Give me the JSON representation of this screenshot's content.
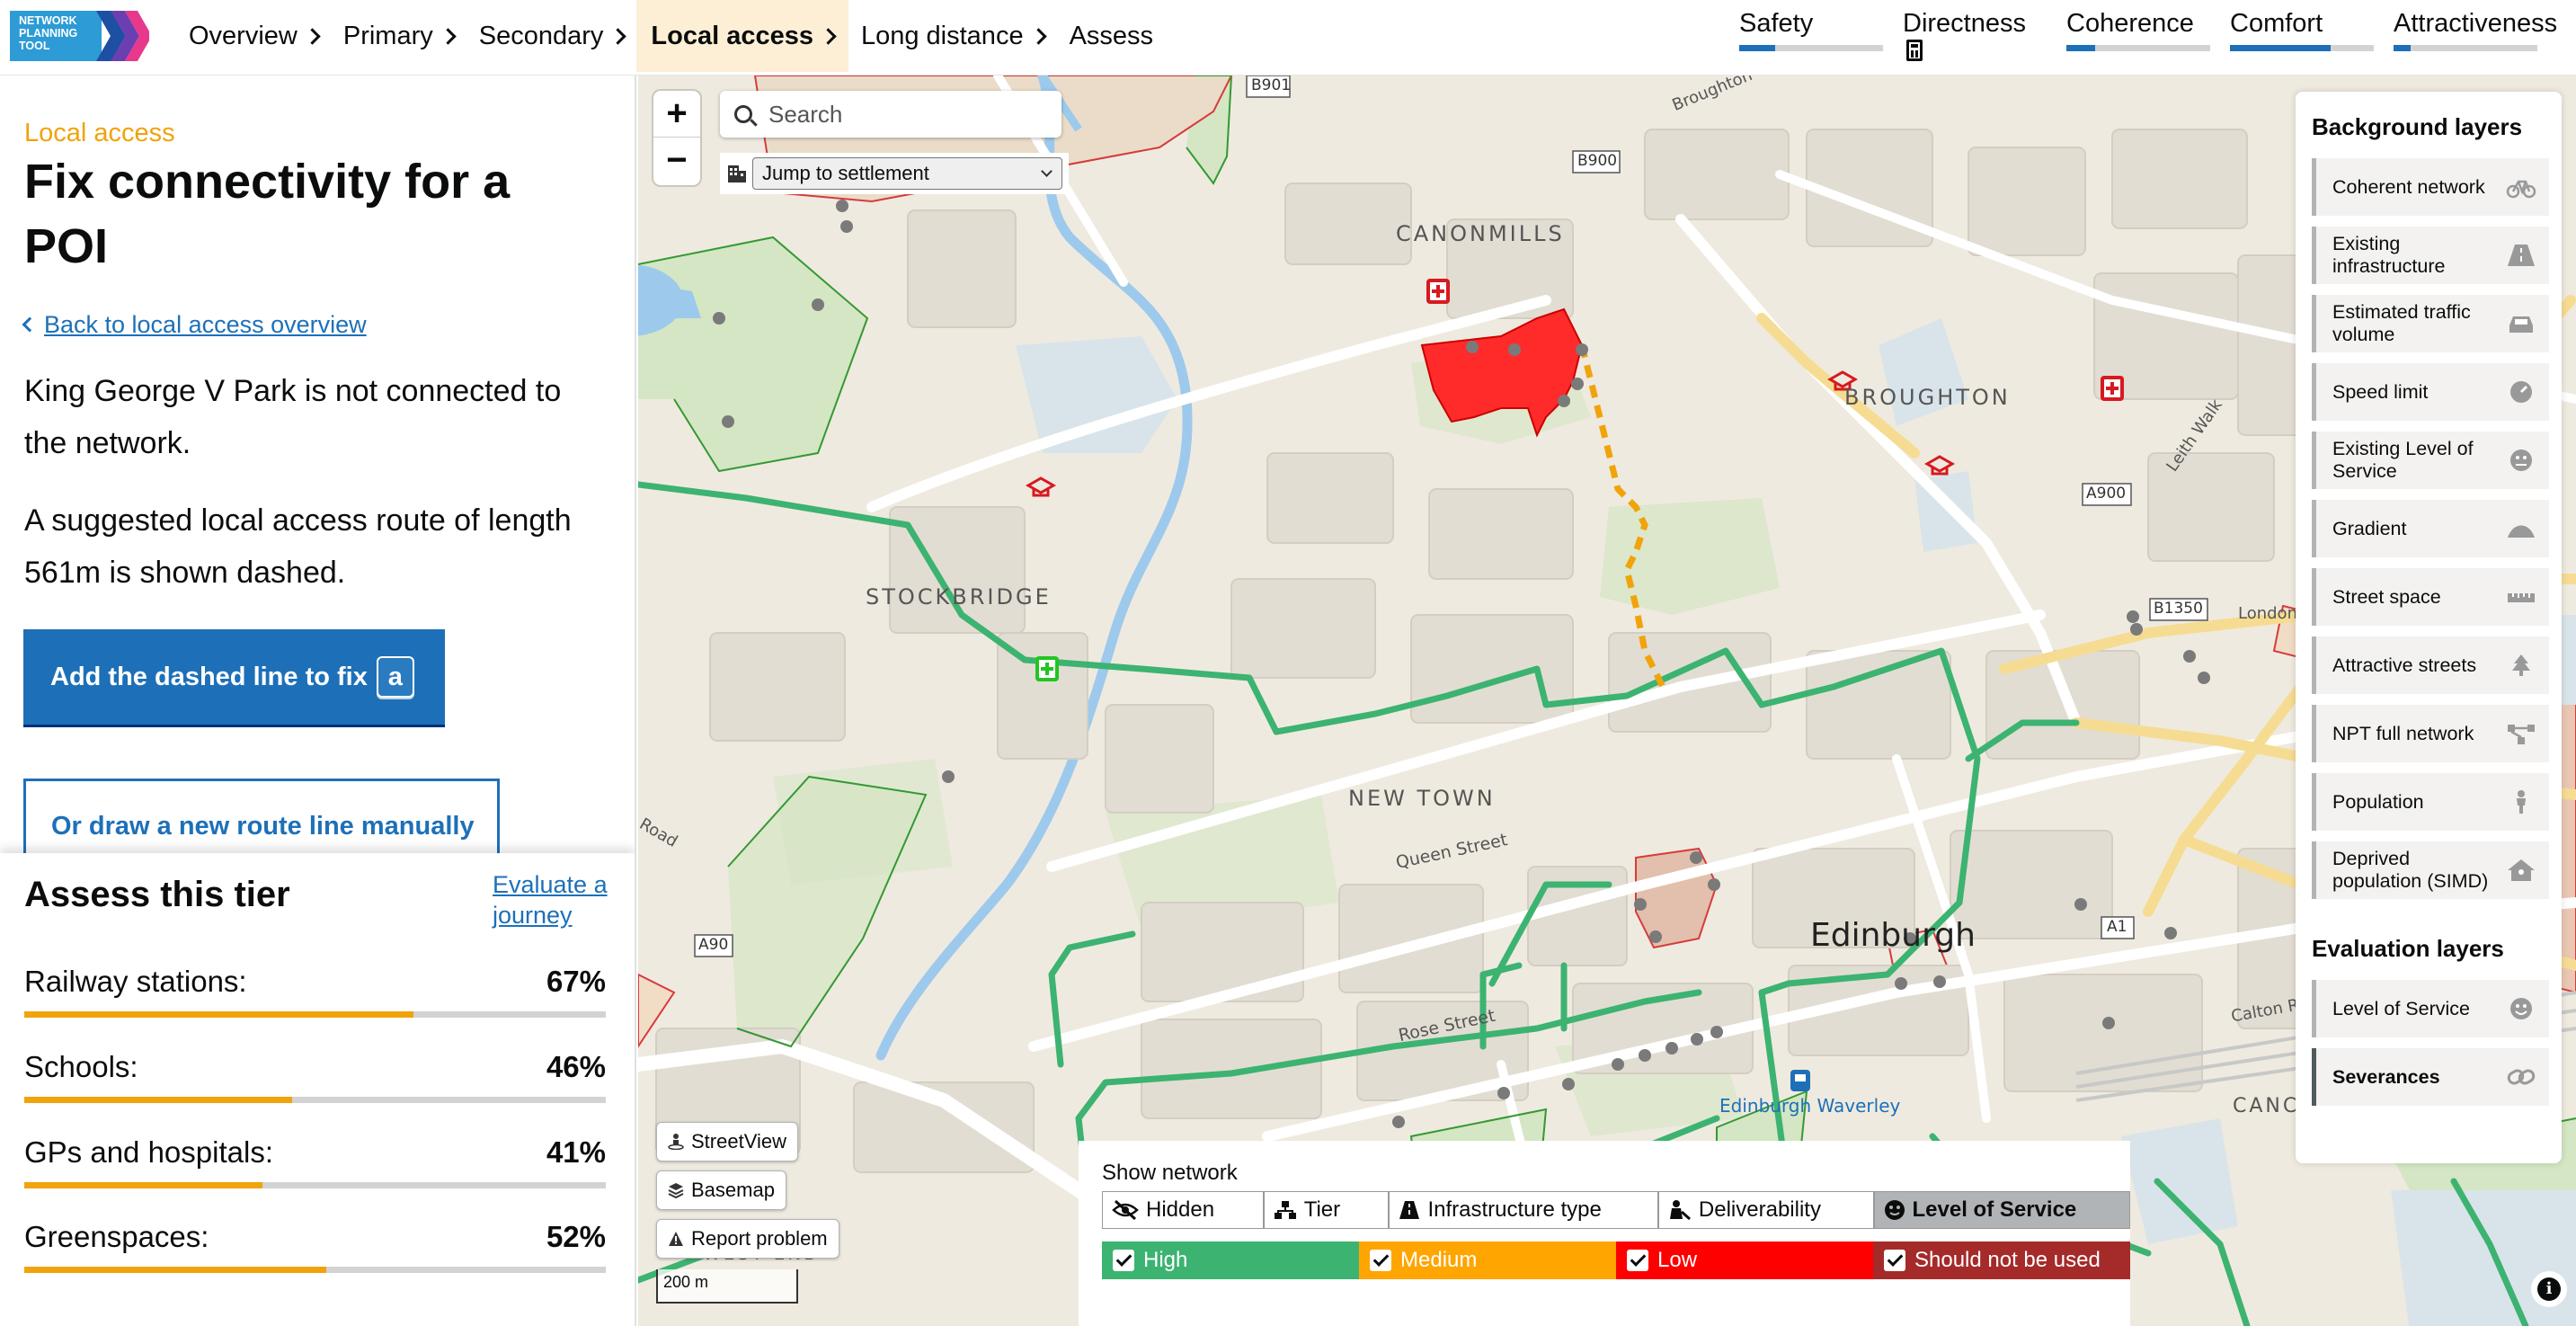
{
  "app": {
    "logo_text": "Network Planning Tool"
  },
  "nav": {
    "items": [
      {
        "label": "Overview"
      },
      {
        "label": "Primary"
      },
      {
        "label": "Secondary"
      },
      {
        "label": "Local access"
      },
      {
        "label": "Long distance"
      },
      {
        "label": "Assess"
      }
    ],
    "active": "Local access"
  },
  "metrics": [
    {
      "label": "Safety",
      "level": 0.25
    },
    {
      "label": "Directness",
      "level": 0
    },
    {
      "label": "Coherence",
      "level": 0.2
    },
    {
      "label": "Comfort",
      "level": 0.7
    },
    {
      "label": "Attractiveness",
      "level": 0.12
    }
  ],
  "sidebar": {
    "caption": "Local access",
    "title": "Fix connectivity for a POI",
    "back_link": "Back to local access overview",
    "para1": "King George V Park is not connected to the network.",
    "para2": "A suggested local access route of length 561m is shown dashed.",
    "primary_button": "Add the dashed line to fix",
    "primary_key": "a",
    "secondary_button": "Or draw a new route line manually"
  },
  "assess": {
    "title": "Assess this tier",
    "evaluate_link": "Evaluate a journey",
    "stats": [
      {
        "label": "Railway stations:",
        "value": "67%",
        "fraction": 0.67
      },
      {
        "label": "Schools:",
        "value": "46%",
        "fraction": 0.46
      },
      {
        "label": "GPs and hospitals:",
        "value": "41%",
        "fraction": 0.41
      },
      {
        "label": "Greenspaces:",
        "value": "52%",
        "fraction": 0.52
      }
    ]
  },
  "map": {
    "search_placeholder": "Search",
    "jump_label": "Jump to settlement",
    "labels": {
      "canonmills": "CANONMILLS",
      "broughton": "BROUGHTON",
      "stockbridge": "STOCKBRIDGE",
      "new_town": "NEW TOWN",
      "edinburgh": "Edinburgh",
      "waverley": "Edinburgh Waverley",
      "queen_street": "Queen Street",
      "rose_street": "Rose Street",
      "leith_walk": "Leith Walk",
      "broughton_rd": "Broughton",
      "london": "London",
      "calton": "Calton R",
      "canc": "CANC",
      "road": "Road",
      "west_end": "WEST END",
      "b901": "B901",
      "b900": "B900",
      "a900": "A900",
      "b1350": "B1350",
      "a90": "A90",
      "a1": "A1"
    },
    "buttons": {
      "streetview": "StreetView",
      "basemap": "Basemap",
      "report": "Report problem"
    },
    "scale": "200 m",
    "info": "i"
  },
  "layers": {
    "background_title": "Background layers",
    "background": [
      {
        "label": "Coherent network",
        "icon": "bicycle-icon"
      },
      {
        "label": "Existing infrastructure",
        "icon": "road-icon"
      },
      {
        "label": "Estimated traffic volume",
        "icon": "car-icon"
      },
      {
        "label": "Speed limit",
        "icon": "gauge-icon"
      },
      {
        "label": "Existing Level of Service",
        "icon": "face-icon"
      },
      {
        "label": "Gradient",
        "icon": "hill-icon"
      },
      {
        "label": "Street space",
        "icon": "ruler-icon"
      },
      {
        "label": "Attractive streets",
        "icon": "tree-icon"
      },
      {
        "label": "NPT full network",
        "icon": "network-icon"
      },
      {
        "label": "Population",
        "icon": "person-icon"
      },
      {
        "label": "Deprived population (SIMD)",
        "icon": "house-icon"
      }
    ],
    "evaluation_title": "Evaluation layers",
    "evaluation": [
      {
        "label": "Level of Service",
        "icon": "smile-icon",
        "active": false
      },
      {
        "label": "Severances",
        "icon": "link-icon",
        "active": true
      }
    ]
  },
  "legend": {
    "title": "Show network",
    "tabs": [
      {
        "label": "Hidden",
        "icon": "eye-slash-icon"
      },
      {
        "label": "Tier",
        "icon": "tier-icon"
      },
      {
        "label": "Infrastructure type",
        "icon": "road-icon"
      },
      {
        "label": "Deliverability",
        "icon": "worker-icon"
      },
      {
        "label": "Level of Service",
        "icon": "face-icon"
      }
    ],
    "selected_tab": "Level of Service",
    "items": [
      {
        "label": "High",
        "color": "#3cb371"
      },
      {
        "label": "Medium",
        "color": "#ffa500"
      },
      {
        "label": "Low",
        "color": "#ff0000"
      },
      {
        "label": "Should not be used",
        "color": "#a52a2a"
      }
    ]
  }
}
